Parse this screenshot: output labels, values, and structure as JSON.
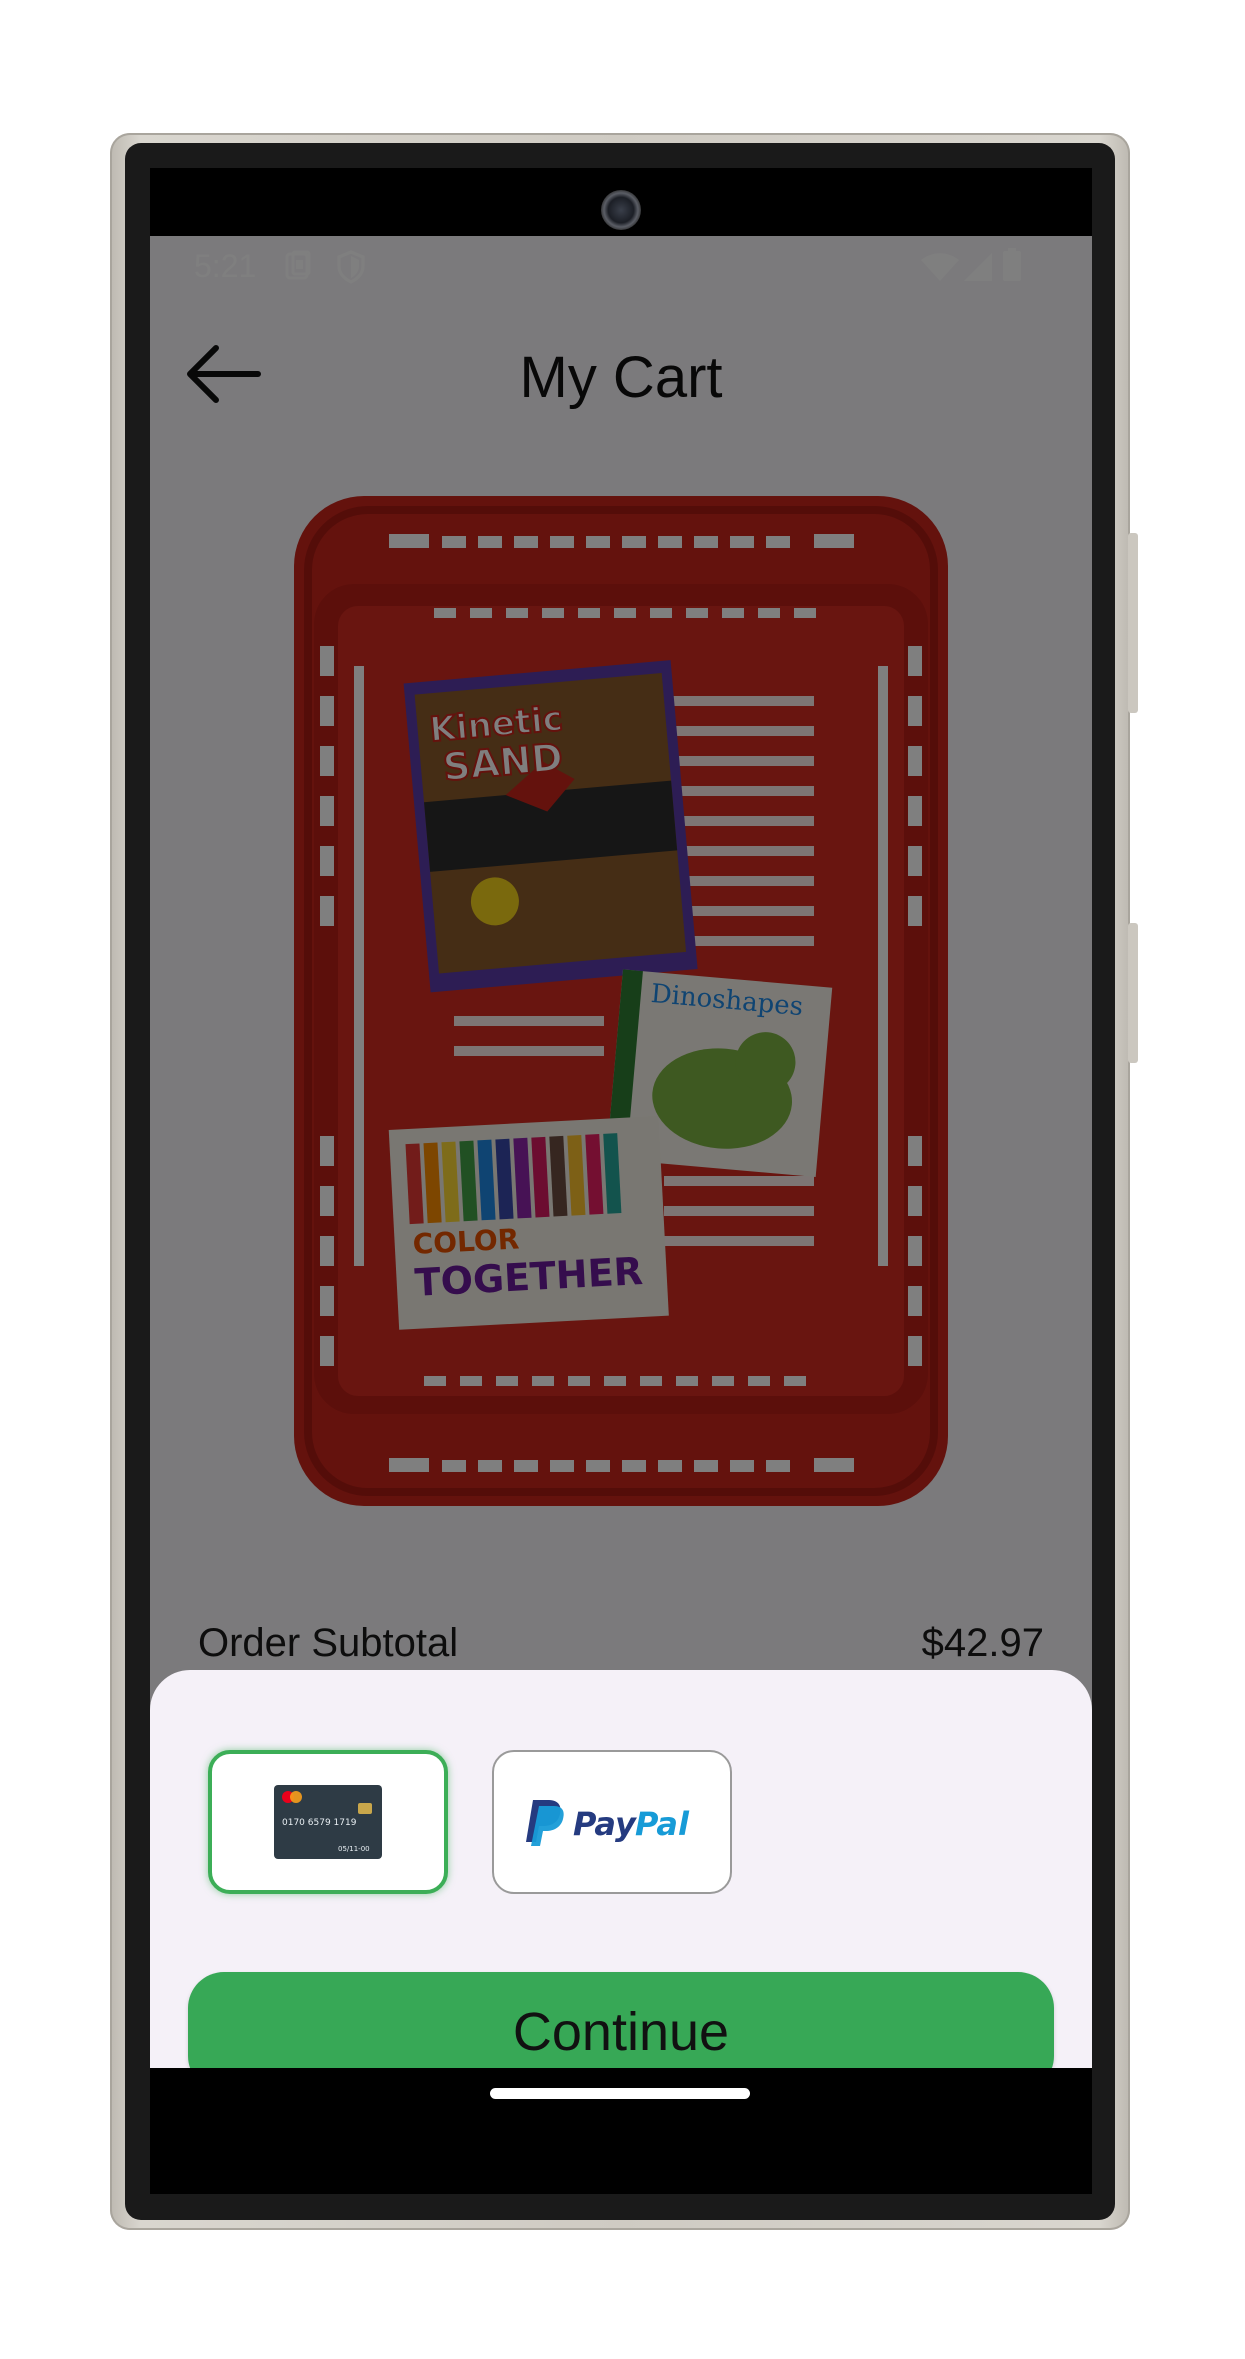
{
  "status_bar": {
    "time": "5:21",
    "icons": [
      "sim-card-icon",
      "shield-icon",
      "wifi-icon",
      "cellular-signal-icon",
      "battery-icon"
    ]
  },
  "header": {
    "title": "My Cart",
    "back_icon": "arrow-left-icon"
  },
  "cart": {
    "image_description_icon": "shopping-basket-with-toys-image",
    "product_texts": [
      "Kinetic SAND",
      "Dinoshapes",
      "COLOR TOGETHER"
    ],
    "subtotal_label": "Order Subtotal",
    "subtotal_value": "$42.97"
  },
  "payment_sheet": {
    "options": [
      {
        "id": "card",
        "icon": "credit-card-icon",
        "selected": true,
        "card_number": "0170 6579 1719",
        "card_expiry": "05/11-00"
      },
      {
        "id": "paypal",
        "icon": "paypal-logo-icon",
        "selected": false,
        "logo_text": "PayPal"
      }
    ],
    "continue_label": "Continue"
  },
  "colors": {
    "accent_green": "#37a856",
    "selected_border": "#3cae57",
    "sheet_bg": "#f5f1f8",
    "basket_red": "#c8241b",
    "paypal_dark_blue": "#253b80",
    "paypal_light_blue": "#179bd7"
  }
}
